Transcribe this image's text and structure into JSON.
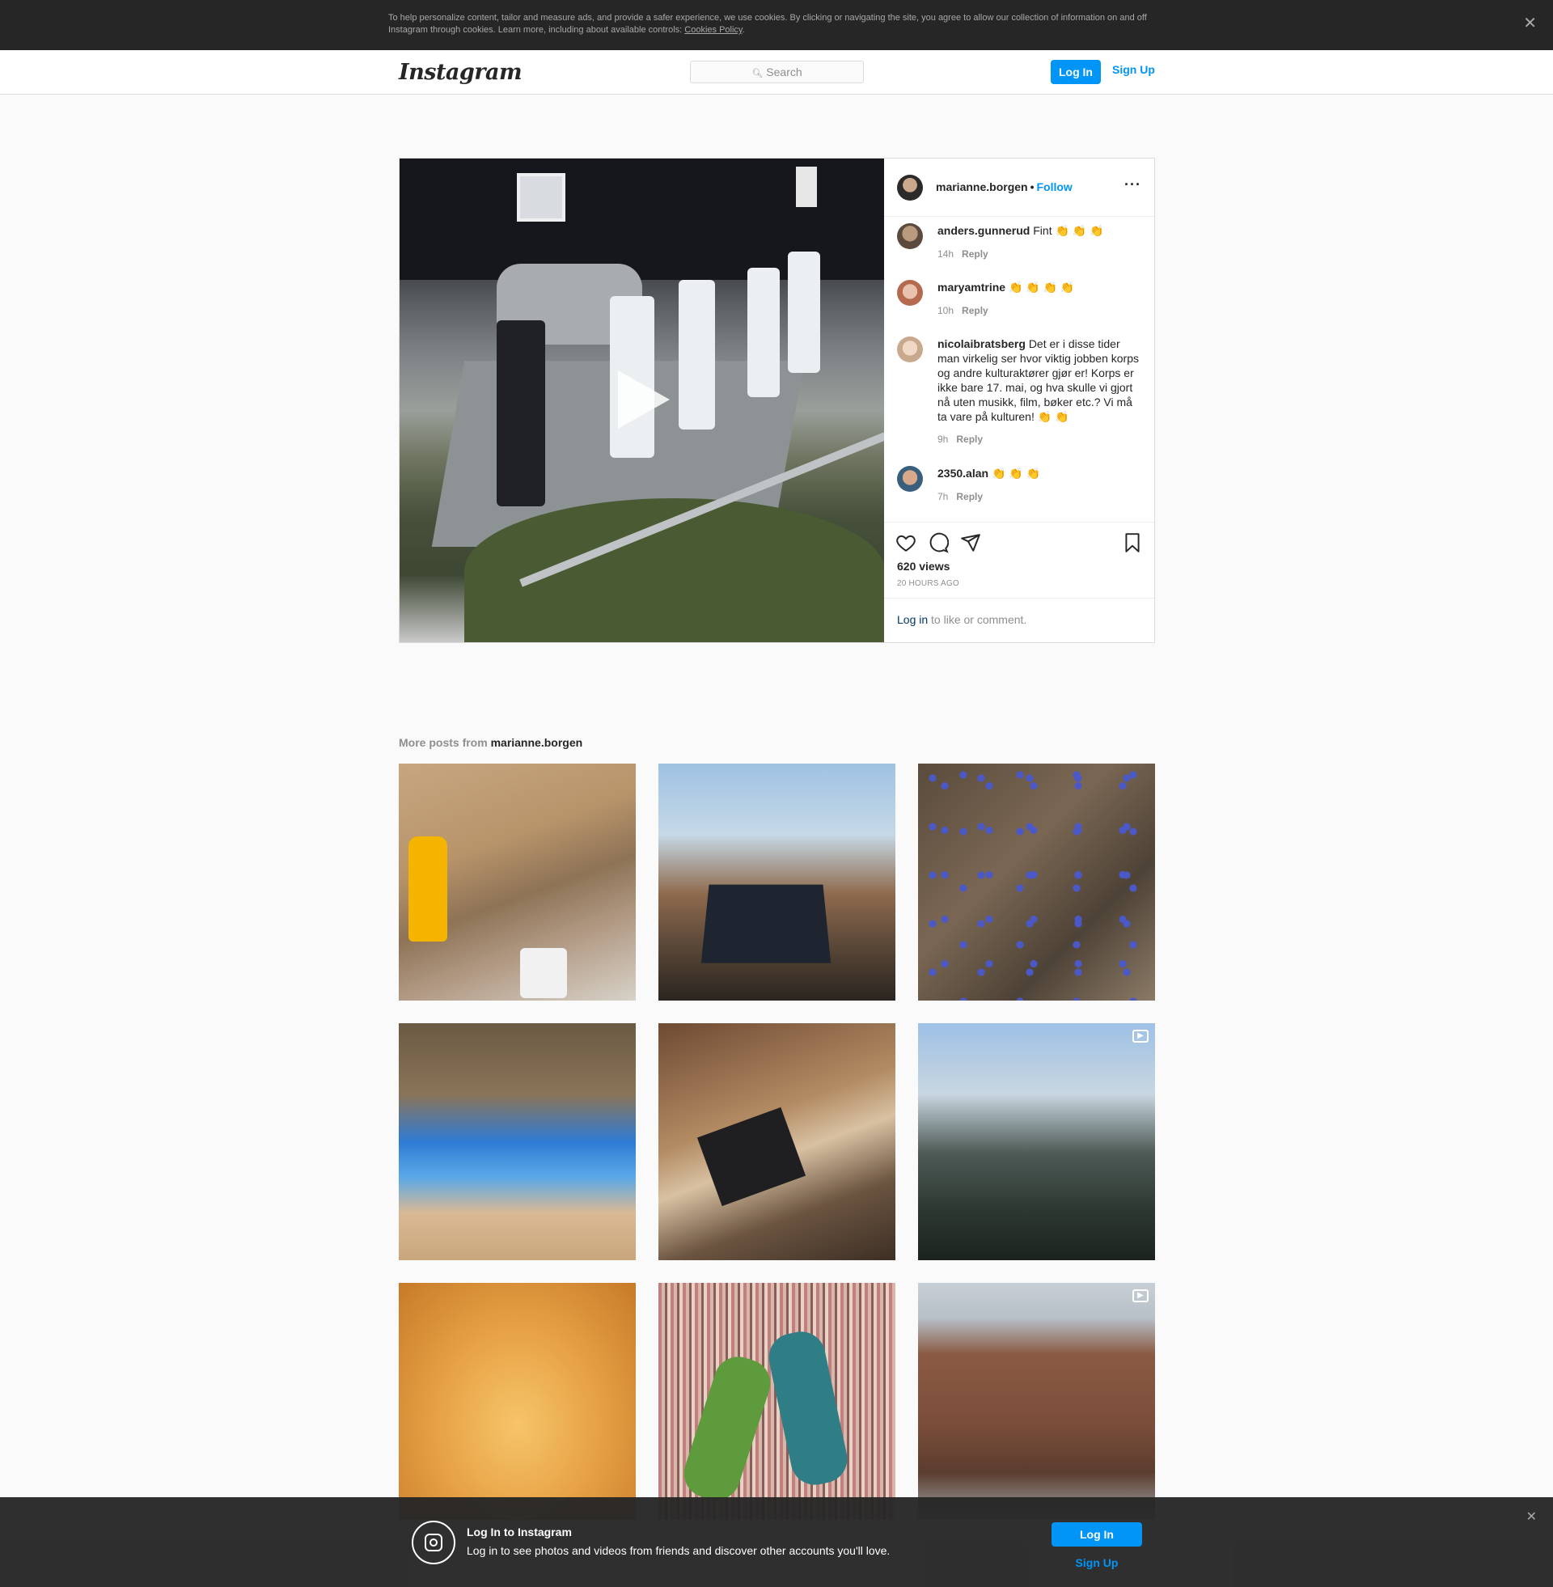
{
  "cookie": {
    "text": "To help personalize content, tailor and measure ads, and provide a safer experience, we use cookies. By clicking or navigating the site, you agree to allow our collection of information on and off Instagram through cookies. Learn more, including about available controls: ",
    "link": "Cookies Policy",
    "end": ".",
    "close": "✕"
  },
  "nav": {
    "logo": "Instagram",
    "search_placeholder": "Search",
    "login": "Log In",
    "signup": "Sign Up"
  },
  "post": {
    "username": "marianne.borgen",
    "separator": "•",
    "follow": "Follow",
    "more": "···",
    "views": "620 views",
    "time": "20 HOURS AGO",
    "login_link": "Log in",
    "login_text": " to like or comment.",
    "comments": [
      {
        "user": "anders.gunnerud",
        "text": "Fint 👏 👏 👏",
        "age": "14h",
        "reply": "Reply"
      },
      {
        "user": "maryamtrine",
        "text": "👏 👏 👏 👏",
        "age": "10h",
        "reply": "Reply"
      },
      {
        "user": "nicolaibratsberg",
        "text": "Det er i disse tider man virkelig ser hvor viktig jobben korps og andre kulturaktører gjør er! Korps er ikke bare 17. mai, og hva skulle vi gjort nå uten musikk, film, bøker etc.? Vi må ta vare på kulturen! 👏 👏",
        "age": "9h",
        "reply": "Reply"
      },
      {
        "user": "2350.alan",
        "text": "👏 👏 👏",
        "age": "7h",
        "reply": "Reply"
      }
    ]
  },
  "more_posts": {
    "prefix": "More posts from ",
    "user": "marianne.borgen",
    "tiles": [
      {
        "video": false
      },
      {
        "video": false
      },
      {
        "video": false
      },
      {
        "video": false
      },
      {
        "video": false
      },
      {
        "video": true
      },
      {
        "video": false
      },
      {
        "video": false
      },
      {
        "video": true
      }
    ]
  },
  "bottom": {
    "title": "Log In to Instagram",
    "subtitle": "Log in to see photos and videos from friends and discover other accounts you'll love.",
    "login": "Log In",
    "signup": "Sign Up",
    "close": "✕"
  },
  "colors": {
    "accent": "#0095f6",
    "dark_bar": "#262626"
  }
}
